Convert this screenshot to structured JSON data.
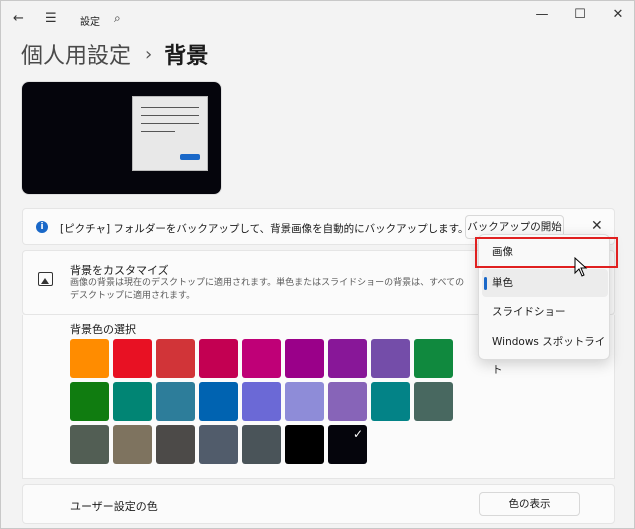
{
  "titlebar": {
    "title": "設定"
  },
  "breadcrumb": {
    "parent": "個人用設定",
    "separator": "›",
    "current": "背景"
  },
  "infobar": {
    "text": "[ピクチャ] フォルダーをバックアップして、背景画像を自動的にバックアップします。",
    "button": "バックアップの開始",
    "close": "✕"
  },
  "customize": {
    "title": "背景をカスタマイズ",
    "description": "画像の背景は現在のデスクトップに適用されます。単色またはスライドショーの背景は、すべてのデスクトップに適用されます。"
  },
  "colors": {
    "title": "背景色の選択",
    "swatches": [
      "#ff8c00",
      "#e81123",
      "#d13438",
      "#c30052",
      "#bf0077",
      "#9a0089",
      "#881798",
      "#744da9",
      "#10893e",
      "#107c10",
      "#018574",
      "#2d7d9a",
      "#0063b1",
      "#6b69d6",
      "#8e8cd8",
      "#8764b8",
      "#038387",
      "#486860",
      "#525e54",
      "#7e735f",
      "#4c4a48",
      "#515c6b",
      "#4a5459",
      "#000000",
      "#05050c"
    ],
    "selected_index": 24
  },
  "custom_color": {
    "label": "ユーザー設定の色",
    "button": "色の表示"
  },
  "dropdown": {
    "options": [
      "画像",
      "単色",
      "スライドショー",
      "Windows スポットライト"
    ],
    "selected_index": 1,
    "highlighted_index": 0
  },
  "colors_accent": {
    "accent": "#1a68c8",
    "highlight_border": "#e02020"
  }
}
